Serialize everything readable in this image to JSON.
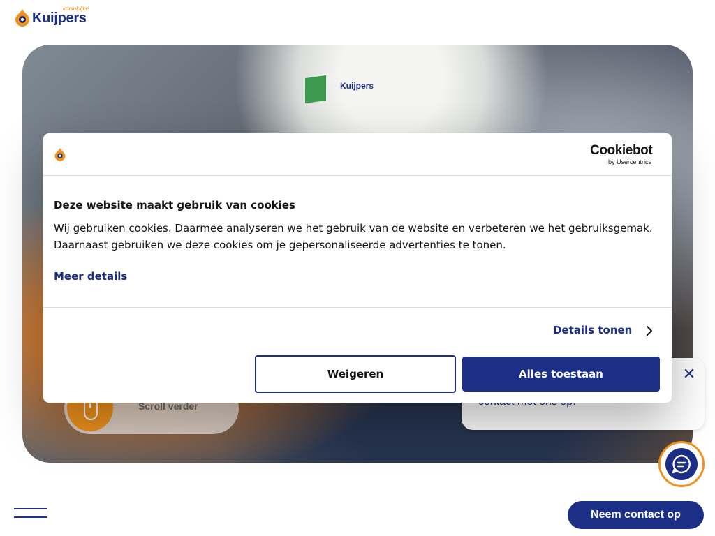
{
  "header": {
    "logo_text": "Kuijpers",
    "logo_super": "koninklijke"
  },
  "hero": {
    "helmet_brand": "Kuijpers",
    "scroll_label": "Scroll verder"
  },
  "chat": {
    "bubble_text": "contact met ons op.",
    "close_symbol": "✕"
  },
  "footer": {
    "contact_label": "Neem contact op"
  },
  "cookie_banner": {
    "provider_brand": "Cookiebot",
    "provider_by": "by Usercentrics",
    "title": "Deze website maakt gebruik van cookies",
    "body": "Wij gebruiken cookies. Daarmee analyseren we het gebruik van de website en verbeteren we het gebruiksgemak. Daarnaast gebruiken we deze cookies om je gepersonaliseerde advertenties te tonen.",
    "more_details": "Meer details",
    "show_details": "Details tonen",
    "deny_label": "Weigeren",
    "allow_label": "Alles toestaan"
  },
  "colors": {
    "brand_blue": "#1c2f86",
    "brand_orange": "#f0921c"
  }
}
